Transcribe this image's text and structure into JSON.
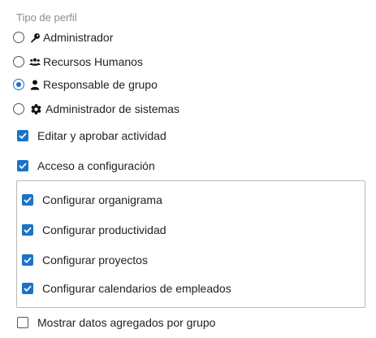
{
  "profile": {
    "label": "Tipo de perfil",
    "options": [
      {
        "label": "Administrador",
        "icon": "key-icon",
        "selected": false
      },
      {
        "label": "Recursos Humanos",
        "icon": "users-icon",
        "selected": false
      },
      {
        "label": "Responsable de grupo",
        "icon": "user-icon",
        "selected": true
      },
      {
        "label": "Administrador de sistemas",
        "icon": "gear-icon",
        "selected": false
      }
    ]
  },
  "permissions": {
    "edit_approve": {
      "label": "Editar y aprobar actividad",
      "checked": true
    },
    "config_access": {
      "label": "Acceso a configuración",
      "checked": true
    },
    "config_items": [
      {
        "label": "Configurar organigrama",
        "checked": true
      },
      {
        "label": "Configurar productividad",
        "checked": true
      },
      {
        "label": "Configurar proyectos",
        "checked": true
      },
      {
        "label": "Configurar calendarios de empleados",
        "checked": true
      }
    ],
    "show_aggregated": {
      "label": "Mostrar datos agregados por grupo",
      "checked": false
    }
  },
  "colors": {
    "accent": "#1a73c8",
    "muted_text": "#8c8c8c",
    "border": "#b8b8b8"
  }
}
